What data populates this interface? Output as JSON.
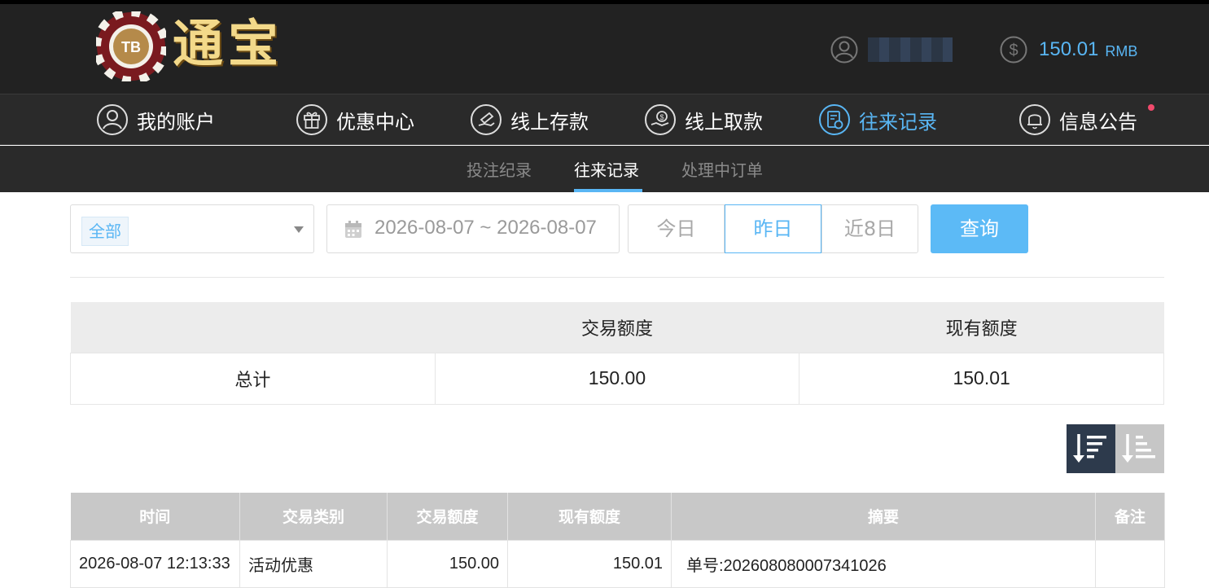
{
  "header": {
    "logo_text": "通宝",
    "logo_chip_label": "TB",
    "balance": "150.01",
    "currency": "RMB",
    "user_icon": "user-icon",
    "balance_icon": "dollar-icon"
  },
  "nav": {
    "items": [
      {
        "label": "我的账户",
        "icon": "user-circle-icon"
      },
      {
        "label": "优惠中心",
        "icon": "gift-icon"
      },
      {
        "label": "线上存款",
        "icon": "deposit-icon"
      },
      {
        "label": "线上取款",
        "icon": "withdraw-icon"
      },
      {
        "label": "往来记录",
        "icon": "records-icon",
        "active": true
      },
      {
        "label": "信息公告",
        "icon": "bell-icon"
      }
    ]
  },
  "subnav": {
    "items": [
      {
        "label": "投注纪录"
      },
      {
        "label": "往来记录",
        "active": true
      },
      {
        "label": "处理中订单"
      }
    ]
  },
  "filter": {
    "type_selected": "全部",
    "date_range": "2026-08-07 ~ 2026-08-07",
    "quick": [
      "今日",
      "昨日",
      "近8日"
    ],
    "quick_active": "昨日",
    "query_label": "查询"
  },
  "summary": {
    "headers": [
      "",
      "交易额度",
      "现有额度"
    ],
    "row": {
      "label": "总计",
      "amount": "150.00",
      "balance": "150.01"
    }
  },
  "sort": {
    "desc_icon": "sort-desc-icon",
    "asc_icon": "sort-asc-icon"
  },
  "records": {
    "headers": [
      "时间",
      "交易类别",
      "交易额度",
      "现有额度",
      "摘要",
      "备注"
    ],
    "rows": [
      {
        "time": "2026-08-07 12:13:33",
        "type": "活动优惠",
        "amount": "150.00",
        "balance": "150.01",
        "summary": "单号:202608080007341026",
        "note": ""
      }
    ]
  },
  "colors": {
    "accent": "#59b6f4",
    "header_bg": "#222222",
    "notify": "#f14a6c"
  }
}
